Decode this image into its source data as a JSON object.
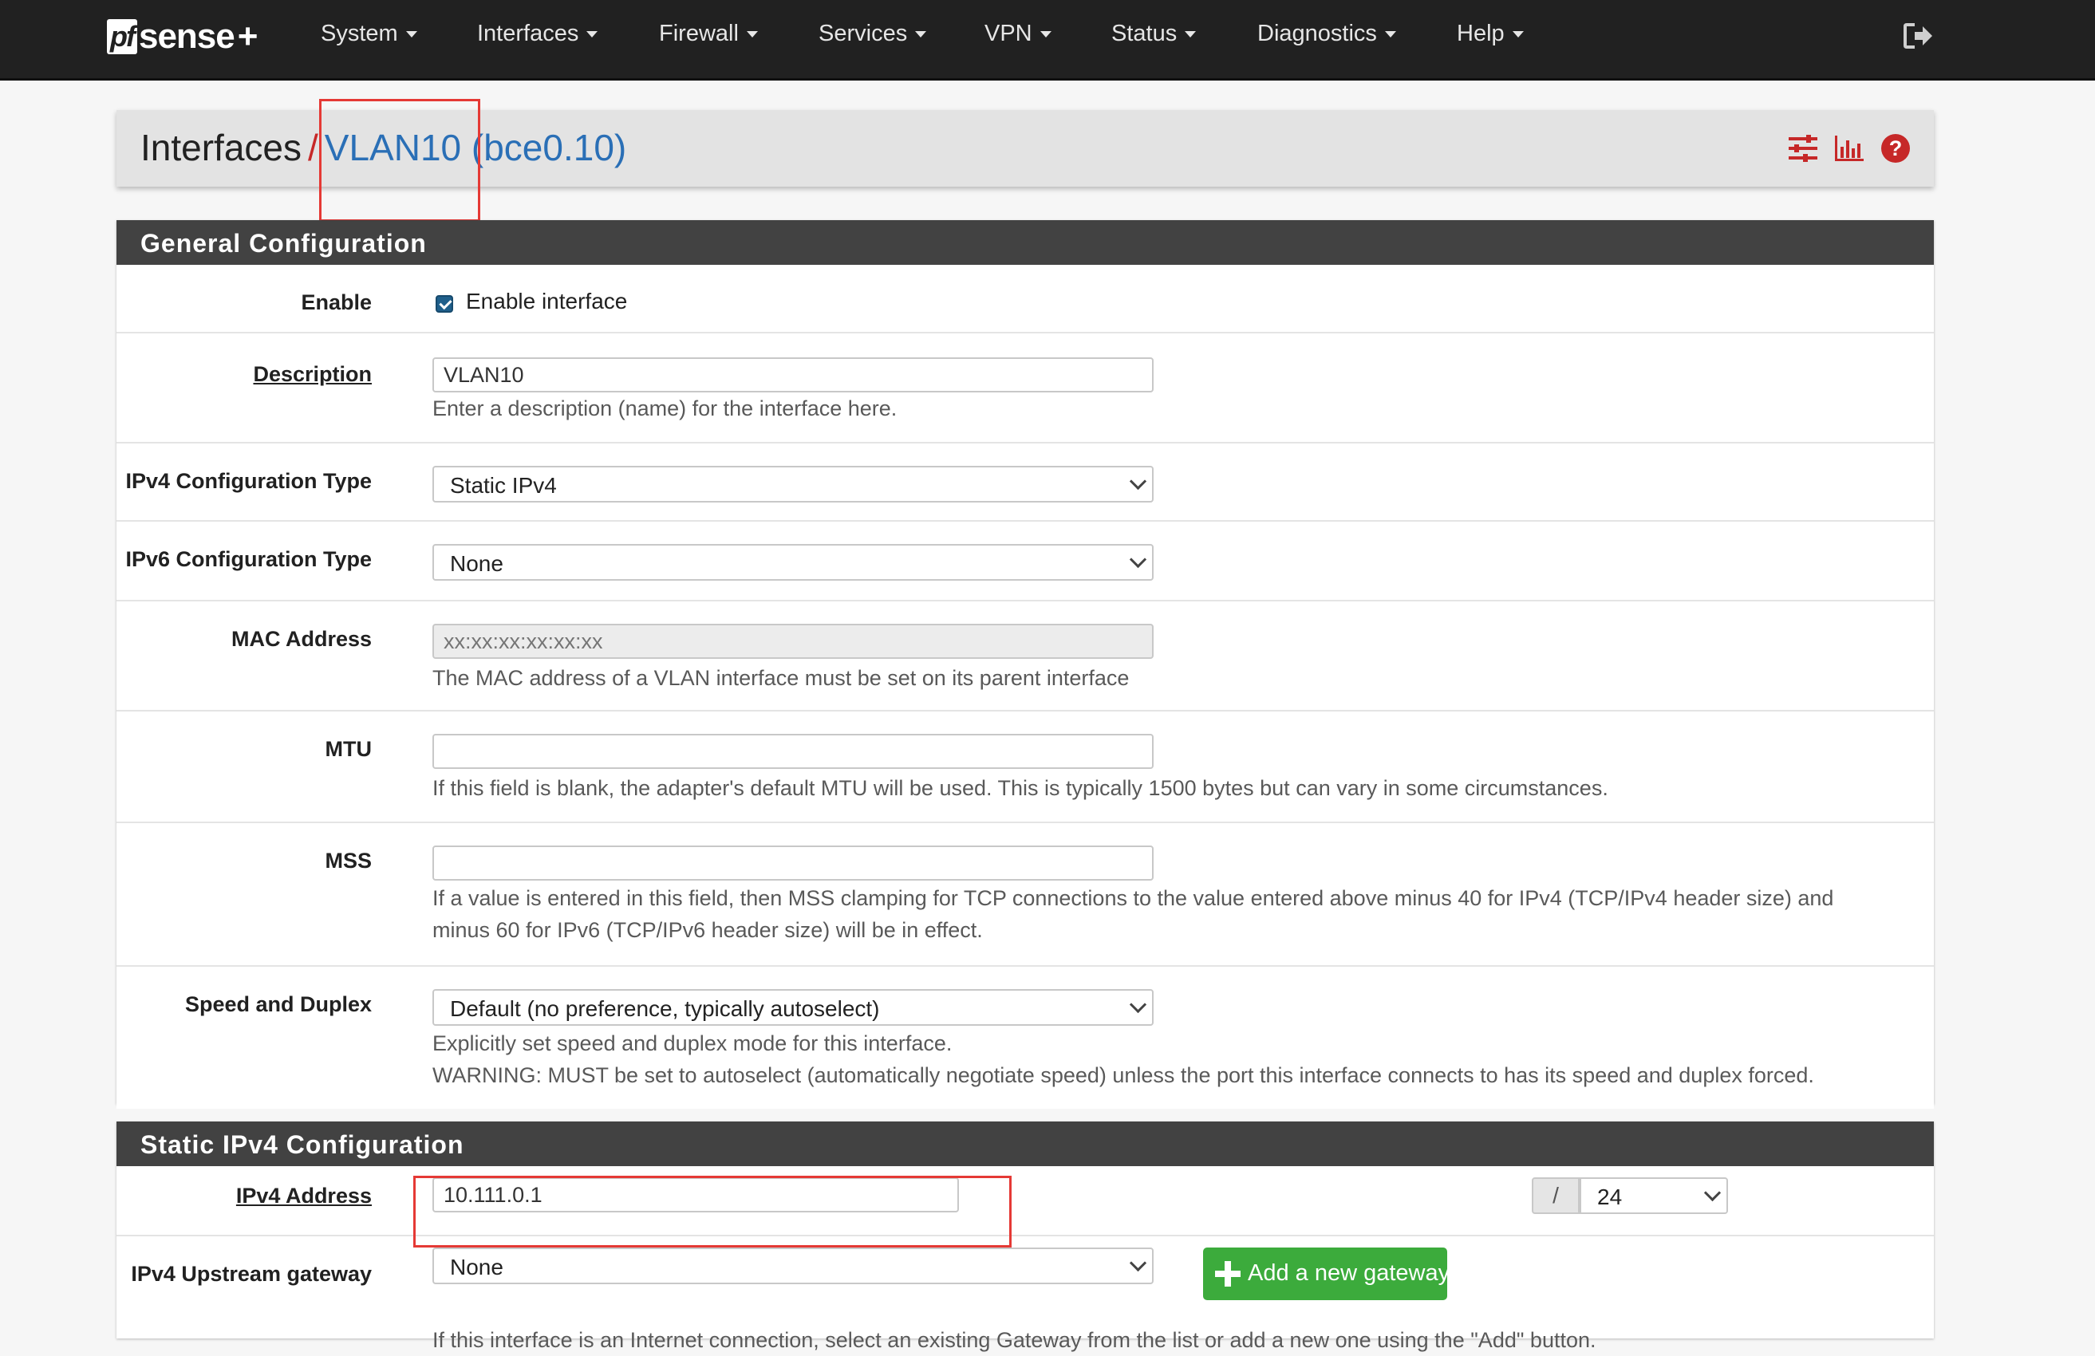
{
  "navbar": {
    "logo_pf": "pf",
    "logo_sense": "sense",
    "logo_plus": "+",
    "menu": [
      {
        "label": "System"
      },
      {
        "label": "Interfaces"
      },
      {
        "label": "Firewall"
      },
      {
        "label": "Services"
      },
      {
        "label": "VPN"
      },
      {
        "label": "Status"
      },
      {
        "label": "Diagnostics"
      },
      {
        "label": "Help"
      }
    ],
    "logout_icon": "sign-out-icon"
  },
  "breadcrumb": {
    "root": "Interfaces",
    "separator": "/",
    "current": "VLAN10 (bce0.10)",
    "icons": [
      "sliders-icon",
      "bar-chart-icon",
      "help-icon"
    ]
  },
  "general": {
    "heading": "General Configuration",
    "enable": {
      "label": "Enable",
      "checkbox_label": "Enable interface",
      "checked": true
    },
    "description": {
      "label": "Description",
      "value": "VLAN10",
      "help": "Enter a description (name) for the interface here."
    },
    "ipv4_type": {
      "label": "IPv4 Configuration Type",
      "value": "Static IPv4"
    },
    "ipv6_type": {
      "label": "IPv6 Configuration Type",
      "value": "None"
    },
    "mac": {
      "label": "MAC Address",
      "placeholder": "xx:xx:xx:xx:xx:xx",
      "help": "The MAC address of a VLAN interface must be set on its parent interface"
    },
    "mtu": {
      "label": "MTU",
      "value": "",
      "help": "If this field is blank, the adapter's default MTU will be used. This is typically 1500 bytes but can vary in some circumstances."
    },
    "mss": {
      "label": "MSS",
      "value": "",
      "help_line1": "If a value is entered in this field, then MSS clamping for TCP connections to the value entered above minus 40 for IPv4 (TCP/IPv4 header size) and",
      "help_line2": "minus 60 for IPv6 (TCP/IPv6 header size) will be in effect."
    },
    "speed": {
      "label": "Speed and Duplex",
      "value": "Default (no preference, typically autoselect)",
      "help_line1": "Explicitly set speed and duplex mode for this interface.",
      "help_line2": "WARNING: MUST be set to autoselect (automatically negotiate speed) unless the port this interface connects to has its speed and duplex forced."
    }
  },
  "static_ipv4": {
    "heading": "Static IPv4 Configuration",
    "address": {
      "label": "IPv4 Address",
      "value": "10.111.0.1",
      "slash": "/",
      "prefix": "24"
    },
    "gateway": {
      "label": "IPv4 Upstream gateway",
      "value": "None",
      "add_button": "Add a new gateway",
      "help": "If this interface is an Internet connection, select an existing Gateway from the list or add a new one using the \"Add\" button."
    }
  },
  "colors": {
    "navbar": "#212121",
    "link": "#2a6fb6",
    "accent_red": "#c62828",
    "success": "#3cab3c",
    "panel_heading": "#424242"
  }
}
